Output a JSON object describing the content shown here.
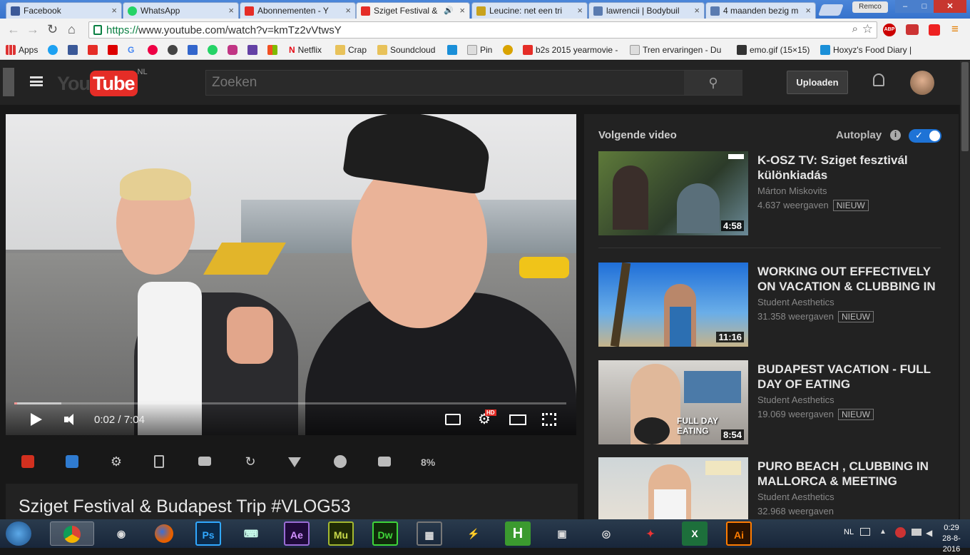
{
  "browser": {
    "tabs": [
      {
        "label": "Facebook",
        "icon_color": "#3b5998"
      },
      {
        "label": "WhatsApp",
        "icon_color": "#25d366"
      },
      {
        "label": "Abonnementen - Y",
        "icon_color": "#e52d27"
      },
      {
        "label": "Sziget Festival &",
        "icon_color": "#e52d27"
      },
      {
        "label": "Leucine: net een tri",
        "icon_color": "#c8a21e"
      },
      {
        "label": "lawrencii | Bodybuil",
        "icon_color": "#5a7bb0"
      },
      {
        "label": "4 maanden bezig m",
        "icon_color": "#5a7bb0"
      }
    ],
    "profile": "Remco",
    "url_scheme": "https://",
    "url_rest": "www.youtube.com/watch?v=kmTz2vVtwsY",
    "bookmarks": [
      "Apps",
      "Netflix",
      "Crap",
      "Soundcloud",
      "Pin",
      "b2s 2015 yearmovie -",
      "Tren ervaringen - Du",
      "emo.gif (15×15)",
      "Hoxyz's Food Diary |"
    ]
  },
  "youtube": {
    "logo_text": "You",
    "logo_tube": "Tube",
    "region": "NL",
    "search_placeholder": "Zoeken",
    "upload_label": "Uploaden",
    "player": {
      "current": "0:02",
      "duration": "7:04",
      "progress": 0.005,
      "hd": "HD"
    },
    "actions_percent": "8%",
    "video_title": "Sziget Festival & Budapest Trip #VLOG53",
    "sidebar": {
      "next_label": "Volgende video",
      "autoplay_label": "Autoplay",
      "recommendations": [
        {
          "title": "K-OSZ TV: Sziget fesztivál különkiadás",
          "channel": "Márton Miskovits",
          "views": "4.637 weergaven",
          "badge": "NIEUW",
          "duration": "4:58"
        },
        {
          "title": "WORKING OUT EFFECTIVELY ON VACATION & CLUBBING IN",
          "channel": "Student Aesthetics",
          "views": "31.358 weergaven",
          "badge": "NIEUW",
          "duration": "11:16"
        },
        {
          "title": "BUDAPEST VACATION - FULL DAY OF EATING",
          "channel": "Student Aesthetics",
          "views": "19.069 weergaven",
          "badge": "NIEUW",
          "duration": "8:54"
        },
        {
          "title": "PURO BEACH , CLUBBING IN MALLORCA & MEETING",
          "channel": "Student Aesthetics",
          "views": "32.968 weergaven",
          "badge": "",
          "duration": ""
        }
      ]
    }
  },
  "taskbar": {
    "lang": "NL",
    "time": "0:29",
    "date": "28-8-2016"
  }
}
